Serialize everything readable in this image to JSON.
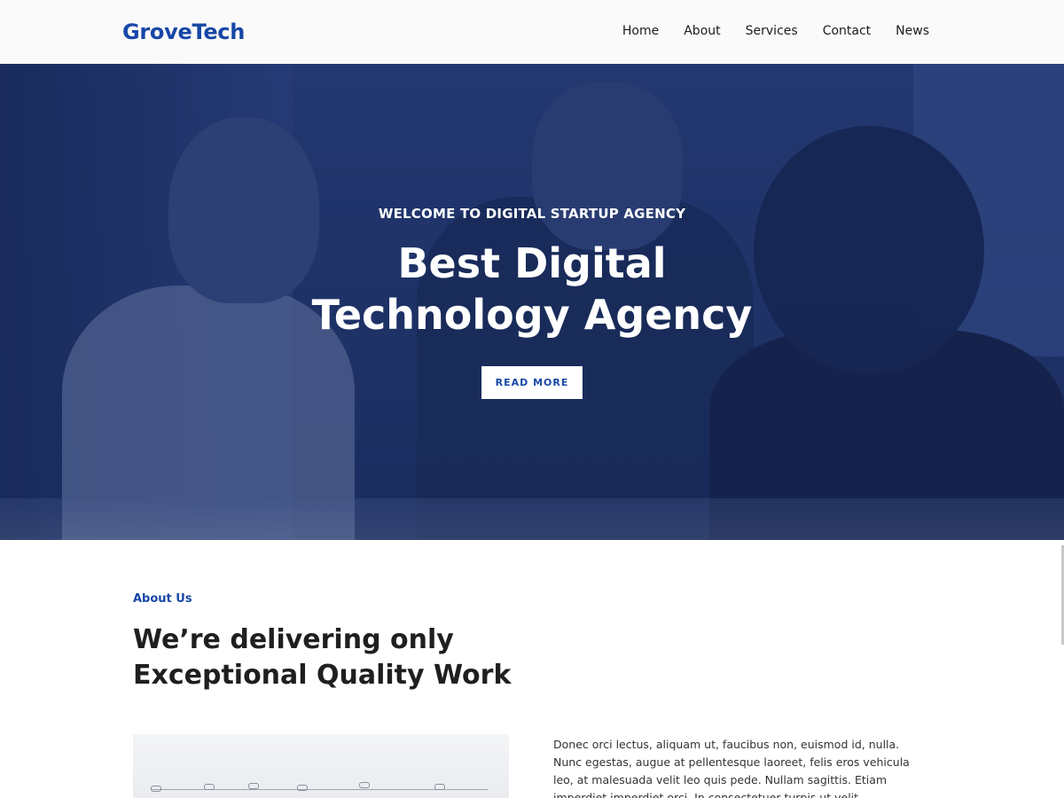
{
  "brand": {
    "logo": "GroveTech",
    "accent": "#1747a6"
  },
  "nav": {
    "items": [
      "Home",
      "About",
      "Services",
      "Contact",
      "News"
    ]
  },
  "hero": {
    "subtitle": "WELCOME TO DIGITAL STARTUP AGENCY",
    "title": "Best Digital Technology Agency",
    "button_label": "READ MORE"
  },
  "about": {
    "label": "About Us",
    "title": "We’re delivering only Exceptional Quality Work",
    "text": "Donec orci lectus, aliquam ut, faucibus non, euismod id, nulla. Nunc egestas, augue at pellentesque laoreet, felis eros vehicula leo, at malesuada velit leo quis pede. Nullam sagittis. Etiam imperdiet imperdiet orci. In consectetuer turpis ut velit."
  }
}
